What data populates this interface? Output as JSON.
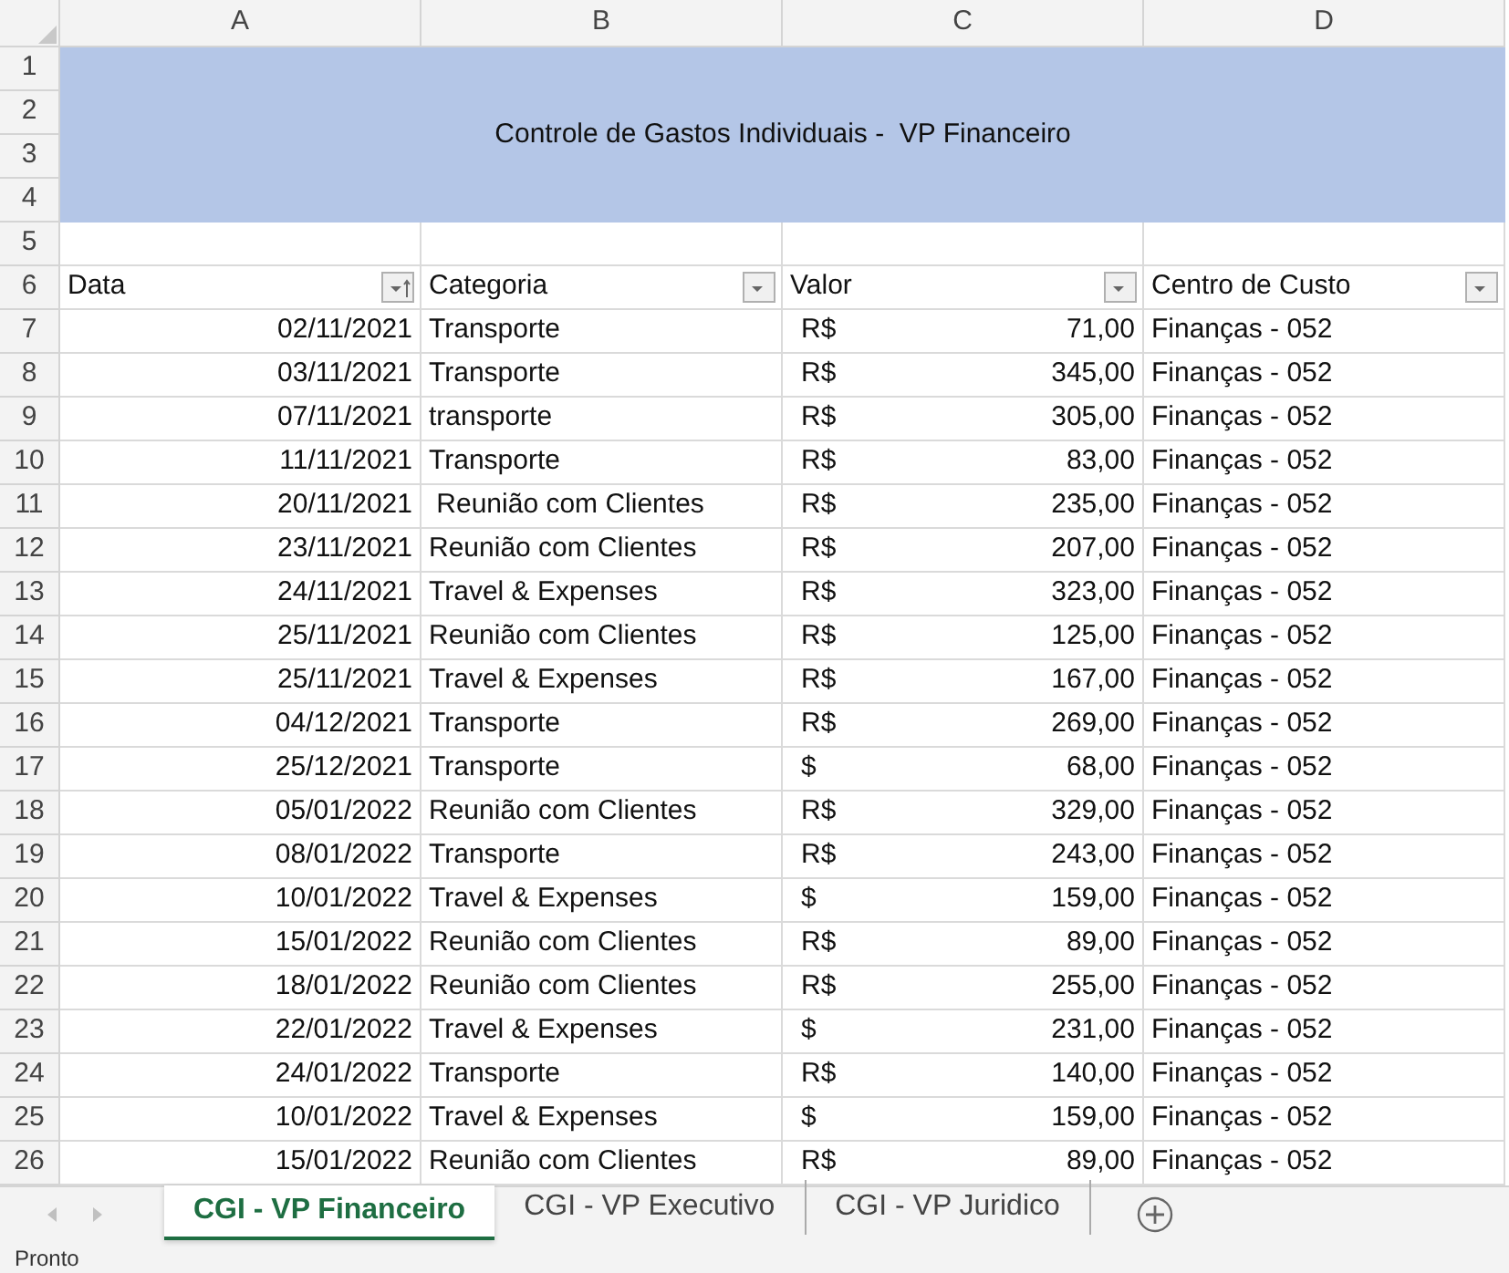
{
  "columns": [
    "A",
    "B",
    "C",
    "D"
  ],
  "title": "Controle de Gastos Individuais -  VP Financeiro",
  "headers": [
    {
      "label": "Data",
      "sorted": true
    },
    {
      "label": "Categoria",
      "sorted": false
    },
    {
      "label": "Valor",
      "sorted": false
    },
    {
      "label": "Centro de Custo",
      "sorted": false
    }
  ],
  "row_numbers": [
    "1",
    "2",
    "3",
    "4",
    "5",
    "6",
    "7",
    "8",
    "9",
    "10",
    "11",
    "12",
    "13",
    "14",
    "15",
    "16",
    "17",
    "18",
    "19",
    "20",
    "21",
    "22",
    "23",
    "24",
    "25",
    "26"
  ],
  "rows": [
    {
      "date": "02/11/2021",
      "category": "Transporte",
      "currency": "R$",
      "amount": "71,00",
      "center": "Finanças - 052"
    },
    {
      "date": "03/11/2021",
      "category": "Transporte",
      "currency": "R$",
      "amount": "345,00",
      "center": "Finanças - 052"
    },
    {
      "date": "07/11/2021",
      "category": "transporte",
      "currency": "R$",
      "amount": "305,00",
      "center": "Finanças - 052"
    },
    {
      "date": "11/11/2021",
      "category": "Transporte",
      "currency": "R$",
      "amount": "83,00",
      "center": "Finanças - 052"
    },
    {
      "date": "20/11/2021",
      "category": " Reunião com Clientes",
      "currency": "R$",
      "amount": "235,00",
      "center": "Finanças - 052"
    },
    {
      "date": "23/11/2021",
      "category": "Reunião com Clientes",
      "currency": "R$",
      "amount": "207,00",
      "center": "Finanças - 052"
    },
    {
      "date": "24/11/2021",
      "category": "Travel & Expenses",
      "currency": "R$",
      "amount": "323,00",
      "center": "Finanças - 052"
    },
    {
      "date": "25/11/2021",
      "category": "Reunião com Clientes",
      "currency": "R$",
      "amount": "125,00",
      "center": "Finanças - 052"
    },
    {
      "date": "25/11/2021",
      "category": "Travel & Expenses",
      "currency": "R$",
      "amount": "167,00",
      "center": "Finanças - 052"
    },
    {
      "date": "04/12/2021",
      "category": "Transporte",
      "currency": "R$",
      "amount": "269,00",
      "center": "Finanças - 052"
    },
    {
      "date": "25/12/2021",
      "category": "Transporte",
      "currency": "$",
      "amount": "68,00",
      "center": "Finanças - 052"
    },
    {
      "date": "05/01/2022",
      "category": "Reunião com Clientes",
      "currency": "R$",
      "amount": "329,00",
      "center": "Finanças - 052"
    },
    {
      "date": "08/01/2022",
      "category": "Transporte",
      "currency": "R$",
      "amount": "243,00",
      "center": "Finanças - 052"
    },
    {
      "date": "10/01/2022",
      "category": "Travel & Expenses",
      "currency": "$",
      "amount": "159,00",
      "center": "Finanças - 052"
    },
    {
      "date": "15/01/2022",
      "category": "Reunião com Clientes",
      "currency": "R$",
      "amount": "89,00",
      "center": "Finanças - 052"
    },
    {
      "date": "18/01/2022",
      "category": "Reunião com Clientes",
      "currency": "R$",
      "amount": "255,00",
      "center": "Finanças - 052"
    },
    {
      "date": "22/01/2022",
      "category": "Travel & Expenses",
      "currency": "$",
      "amount": "231,00",
      "center": "Finanças - 052"
    },
    {
      "date": "24/01/2022",
      "category": "Transporte",
      "currency": "R$",
      "amount": "140,00",
      "center": "Finanças - 052"
    },
    {
      "date": "10/01/2022",
      "category": "Travel & Expenses",
      "currency": "$",
      "amount": "159,00",
      "center": "Finanças - 052"
    },
    {
      "date": "15/01/2022",
      "category": "Reunião com Clientes",
      "currency": "R$",
      "amount": "89,00",
      "center": "Finanças - 052"
    }
  ],
  "sheet_tabs": [
    {
      "label": "CGI - VP Financeiro",
      "selected": true
    },
    {
      "label": "CGI - VP Executivo",
      "selected": false
    },
    {
      "label": "CGI - VP Juridico",
      "selected": false
    }
  ],
  "status_bar": "Pronto"
}
